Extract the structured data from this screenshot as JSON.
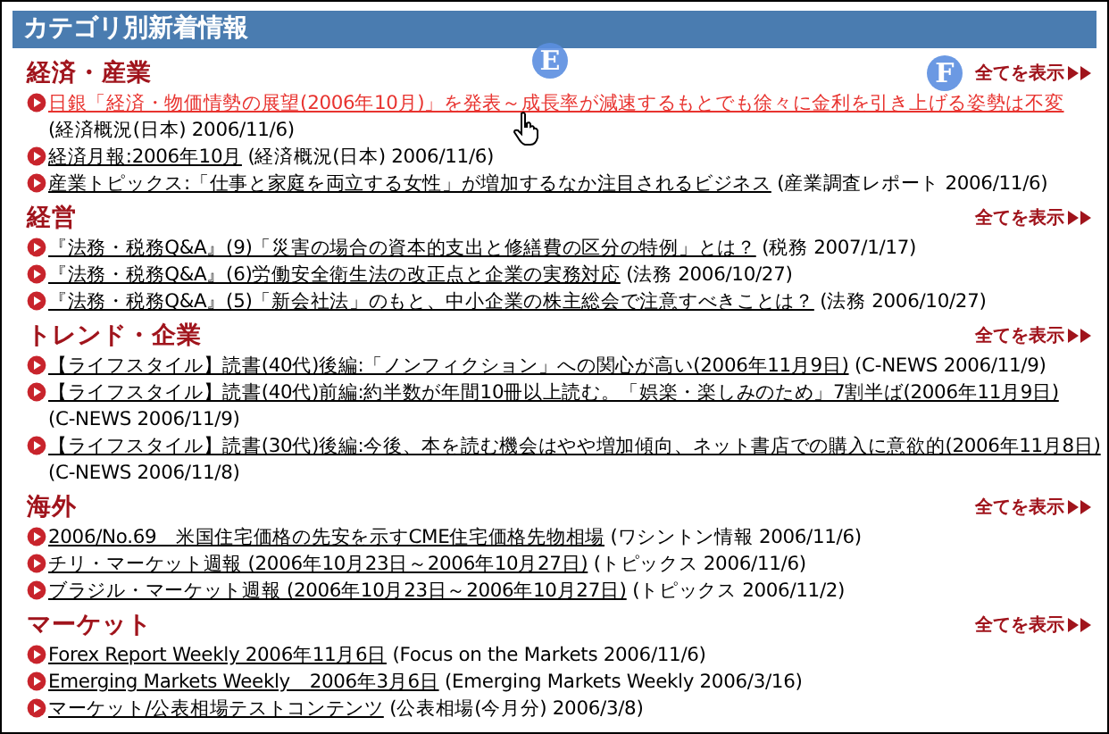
{
  "panel": {
    "title": "カテゴリ別新着情報"
  },
  "sections": [
    {
      "heading": "経済・産業",
      "more": "全てを表示",
      "callout": "F",
      "items": [
        {
          "link": "日銀「経済・物価情勢の展望(2006年10月)」を発表～成長率が減速するもとでも徐々に金利を引き上げる姿勢は不変",
          "source": "(経済概況(日本) 2006/11/6)",
          "hovered": true,
          "callout": "E"
        },
        {
          "link": "経済月報:2006年10月",
          "source": "(経済概況(日本) 2006/11/6)",
          "hovered": false
        },
        {
          "link": "産業トピックス:「仕事と家庭を両立する女性」が増加するなか注目されるビジネス",
          "source": "(産業調査レポート 2006/11/6)",
          "hovered": false
        }
      ]
    },
    {
      "heading": "経営",
      "more": "全てを表示",
      "items": [
        {
          "link": "『法務・税務Q&A』(9)「災害の場合の資本的支出と修繕費の区分の特例」とは？",
          "source": "(税務 2007/1/17)",
          "hovered": false
        },
        {
          "link": "『法務・税務Q&A』(6)労働安全衛生法の改正点と企業の実務対応",
          "source": "(法務 2006/10/27)",
          "hovered": false
        },
        {
          "link": "『法務・税務Q&A』(5)「新会社法」のもと、中小企業の株主総会で注意すべきことは？",
          "source": "(法務 2006/10/27)",
          "hovered": false
        }
      ]
    },
    {
      "heading": "トレンド・企業",
      "more": "全てを表示",
      "items": [
        {
          "link": "【ライフスタイル】読書(40代)後編:「ノンフィクション」への関心が高い(2006年11月9日)",
          "source": "(C-NEWS 2006/11/9)",
          "hovered": false
        },
        {
          "link": "【ライフスタイル】読書(40代)前編:約半数が年間10冊以上読む。「娯楽・楽しみのため」7割半ば(2006年11月9日)",
          "source": "(C-NEWS 2006/11/9)",
          "hovered": false
        },
        {
          "link": "【ライフスタイル】読書(30代)後編:今後、本を読む機会はやや増加傾向、ネット書店での購入に意欲的(2006年11月8日)",
          "source": "(C-NEWS 2006/11/8)",
          "hovered": false
        }
      ]
    },
    {
      "heading": "海外",
      "more": "全てを表示",
      "items": [
        {
          "link": "2006/No.69　米国住宅価格の先安を示すCME住宅価格先物相場",
          "source": "(ワシントン情報 2006/11/6)",
          "hovered": false
        },
        {
          "link": "チリ・マーケット週報 (2006年10月23日～2006年10月27日)",
          "source": "(トピックス 2006/11/6)",
          "hovered": false
        },
        {
          "link": "ブラジル・マーケット週報 (2006年10月23日～2006年10月27日)",
          "source": "(トピックス 2006/11/2)",
          "hovered": false
        }
      ]
    },
    {
      "heading": "マーケット",
      "more": "全てを表示",
      "items": [
        {
          "link": "Forex Report Weekly 2006年11月6日",
          "source": "(Focus on the Markets 2006/11/6)",
          "hovered": false
        },
        {
          "link": "Emerging Markets Weekly　2006年3月6日",
          "source": "(Emerging Markets Weekly 2006/3/16)",
          "hovered": false
        },
        {
          "link": "マーケット/公表相場テストコンテンツ",
          "source": "(公表相場(今月分) 2006/3/8)",
          "hovered": false
        }
      ]
    }
  ]
}
